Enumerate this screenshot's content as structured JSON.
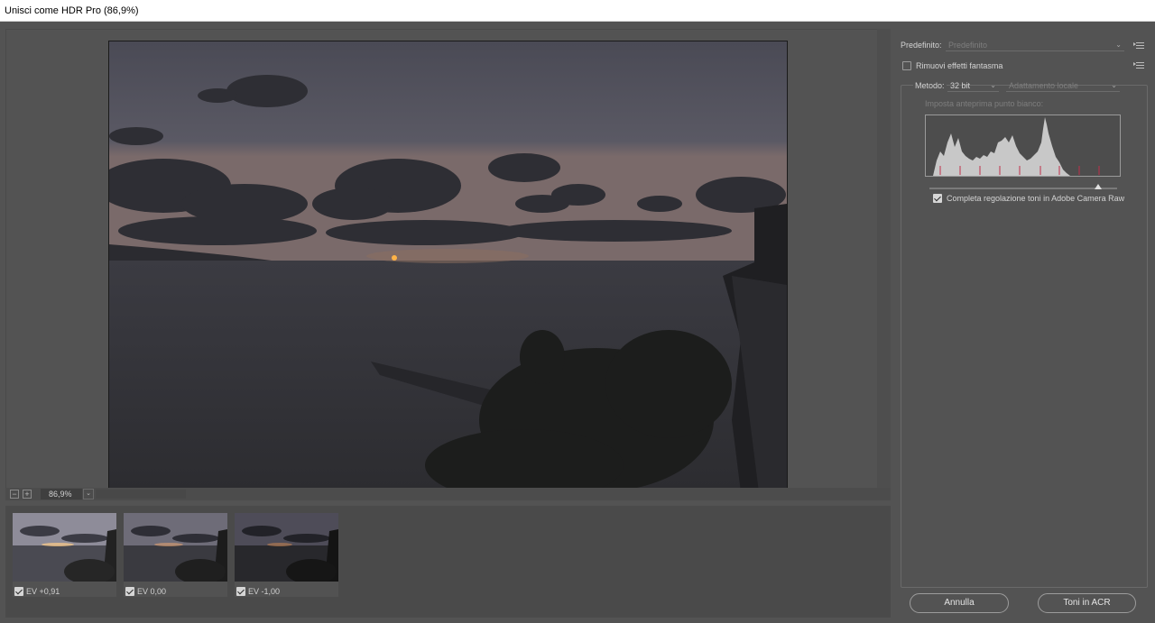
{
  "window": {
    "title": "Unisci come HDR Pro (86,9%)"
  },
  "preview": {
    "zoom_value": "86,9%",
    "zoom_out_glyph": "−",
    "zoom_in_glyph": "+",
    "dropdown_glyph": "⌄"
  },
  "thumbnails": [
    {
      "label": "EV +0,91",
      "checked": true,
      "brightness": "bright"
    },
    {
      "label": "EV 0,00",
      "checked": true,
      "brightness": "normal"
    },
    {
      "label": "EV -1,00",
      "checked": true,
      "brightness": "dark"
    }
  ],
  "panel": {
    "preset_label": "Predefinito:",
    "preset_value": "Predefinito",
    "remove_ghost_label": "Rimuovi effetti fantasma",
    "method_label": "Metodo:",
    "bit_depth_value": "32 bit",
    "method_value": "Adattamento locale",
    "white_point_label": "Imposta anteprima punto bianco:",
    "acr_checkbox_label": "Completa regolazione toni in Adobe Camera Raw",
    "white_point_fraction": 0.9
  },
  "buttons": {
    "cancel": "Annulla",
    "tone_acr": "Toni in ACR"
  },
  "colors": {
    "background": "#535353",
    "panel_border": "#6a6a6a",
    "histogram_fill": "#c8c8c8",
    "clip_marks": "#c0304a",
    "sun": "#ffb347"
  }
}
